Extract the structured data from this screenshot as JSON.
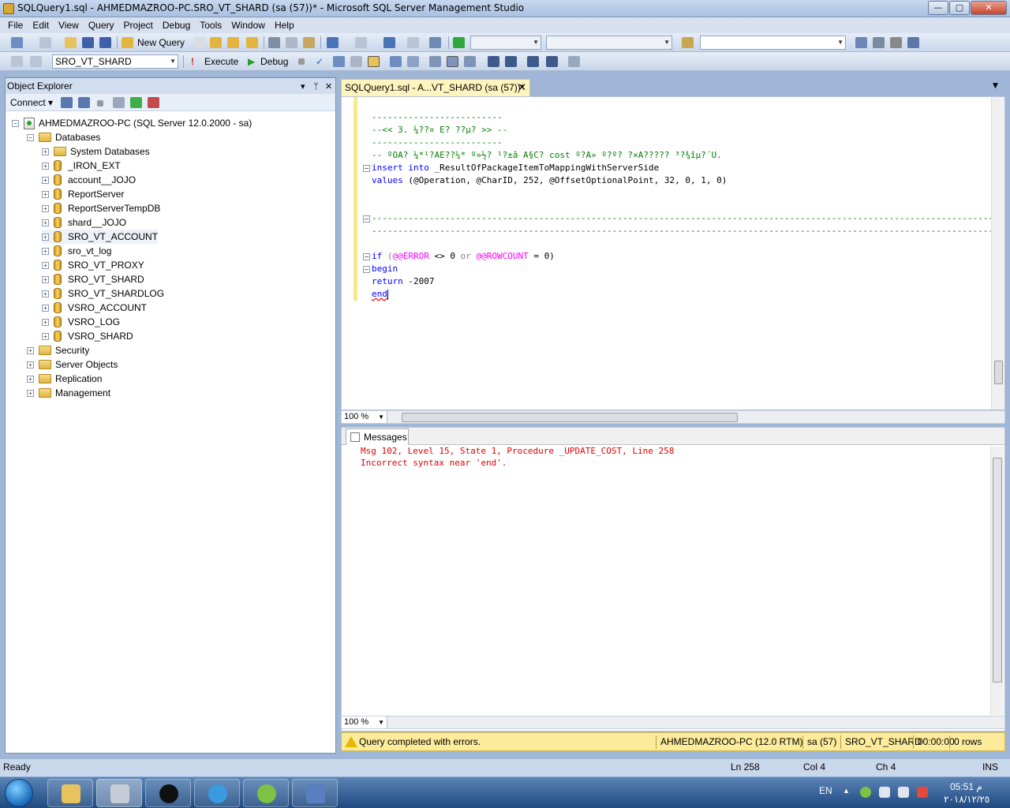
{
  "window": {
    "title": "SQLQuery1.sql - AHMEDMAZROO-PC.SRO_VT_SHARD (sa (57))* - Microsoft SQL Server Management Studio",
    "min_glyph": "—",
    "max_glyph": "▢",
    "close_glyph": "✕"
  },
  "menu": [
    "File",
    "Edit",
    "View",
    "Query",
    "Project",
    "Debug",
    "Tools",
    "Window",
    "Help"
  ],
  "toolbar": {
    "new_query_label": "New Query",
    "database_value": "SRO_VT_SHARD",
    "execute_label": "Execute",
    "debug_label": "Debug"
  },
  "object_explorer": {
    "title": "Object Explorer",
    "connect_label": "Connect ▾",
    "server": "AHMEDMAZROO-PC (SQL Server 12.0.2000 - sa)",
    "databases_label": "Databases",
    "databases": [
      "System Databases",
      "_IRON_EXT",
      "account__JOJO",
      "ReportServer",
      "ReportServerTempDB",
      "shard__JOJO",
      "SRO_VT_ACCOUNT",
      "sro_vt_log",
      "SRO_VT_PROXY",
      "SRO_VT_SHARD",
      "SRO_VT_SHARDLOG",
      "VSRO_ACCOUNT",
      "VSRO_LOG",
      "VSRO_SHARD"
    ],
    "top_nodes": [
      "Security",
      "Server Objects",
      "Replication",
      "Management"
    ]
  },
  "editor": {
    "tab_label": "SQLQuery1.sql - A...VT_SHARD (sa (57))*",
    "tab_close": "✕",
    "zoom": "100 %",
    "lines": {
      "l1": "-------------------------",
      "l2": "--<< 3. ¼??¤ E? ??µ? >> --",
      "l3": "-------------------------",
      "l4": "-- ºOA? ¼*¹?AE??¼* º»½? ¹?±â A§C? cost º?A» º?º? ?×A????? ³?¾îµ?´U.",
      "insert_kw": "insert into",
      "insert_rest": " _ResultOfPackageItemToMappingWithServerSide",
      "values_kw": "values",
      "values_rest": " (@Operation, @CharID, 252, @OffsetOptionalPoint, 32, 0, 1, 0)",
      "sep1": "------------------------------------------------------------------------------------------------------------------------",
      "sep2": "------------------------------------------------------------------------------------------------------------------------",
      "if_kw": "if",
      "if_open": " (",
      "error_var": "@@ERROR",
      "if_mid1": " <> 0 ",
      "or_kw": "or",
      "if_mid2": " ",
      "rowcount_var": "@@ROWCOUNT",
      "if_end": " = 0)",
      "begin_kw": "begin",
      "return_kw": "return",
      "return_rest": " -2007",
      "end_kw": "end"
    }
  },
  "results": {
    "tab_label": "Messages",
    "msg1": "Msg 102, Level 15, State 1, Procedure _UPDATE_COST, Line 258",
    "msg2": "Incorrect syntax near 'end'.",
    "zoom": "100 %"
  },
  "query_status": {
    "message": "Query completed with errors.",
    "server": "AHMEDMAZROO-PC (12.0 RTM)",
    "user": "sa (57)",
    "database": "SRO_VT_SHARD",
    "time": "00:00:00",
    "rows": "0 rows"
  },
  "statusbar": {
    "ready": "Ready",
    "ln": "Ln 258",
    "col": "Col 4",
    "ch": "Ch 4",
    "mode": "INS"
  },
  "taskbar": {
    "lang": "EN",
    "time": "05:51 م",
    "date": "٢٠١٨/١٢/٢٥"
  },
  "colors": {
    "comment": "#008000",
    "keyword": "#0000ff",
    "error_text": "#e00000",
    "system_var": "#ff00ff"
  }
}
